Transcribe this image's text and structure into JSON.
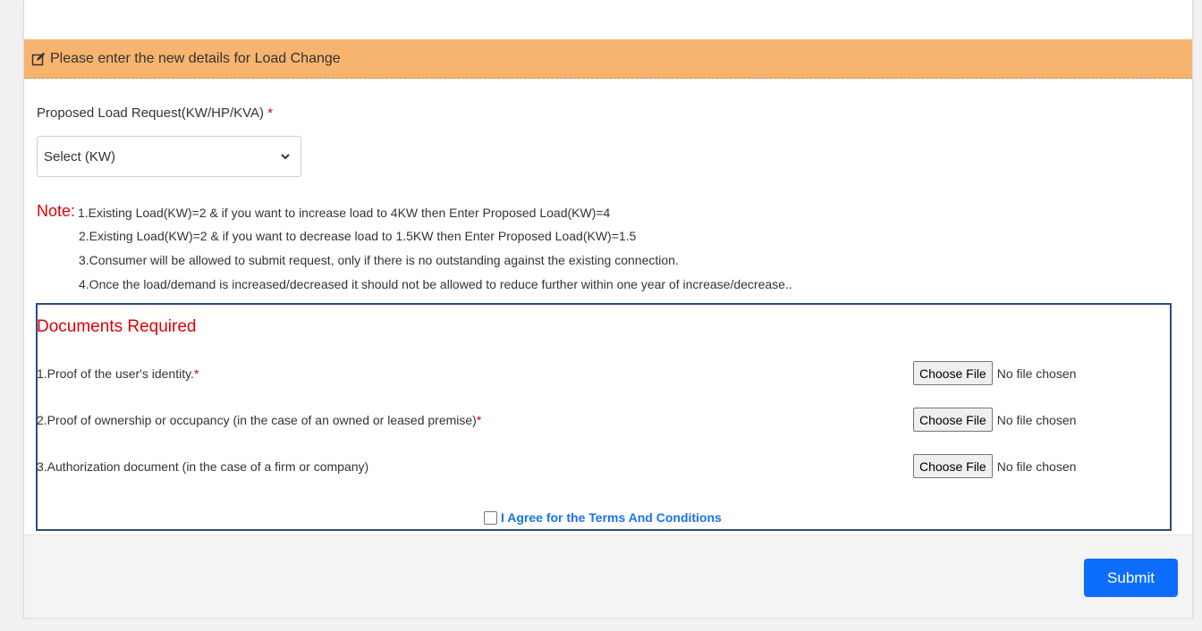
{
  "heading": {
    "title": "Please enter the new details for Load Change",
    "icon": "edit-icon",
    "color": "#f7b46e"
  },
  "load_request": {
    "label": "Proposed Load Request(KW/HP/KVA)",
    "required_mark": "*",
    "selected": "Select (KW)"
  },
  "notes": {
    "label": "Note:",
    "items": [
      "1.Existing Load(KW)=2 & if you want to increase load to 4KW then Enter Proposed Load(KW)=4",
      "2.Existing Load(KW)=2 & if you want to decrease load to 1.5KW then Enter Proposed Load(KW)=1.5",
      "3.Consumer will be allowed to submit request, only if there is no outstanding against the existing connection.",
      "4.Once the load/demand is increased/decreased it should not be allowed to reduce further within one year of increase/decrease.."
    ]
  },
  "documents": {
    "title": "Documents Required",
    "items": [
      {
        "label": "1.Proof of the user's identity.",
        "required_mark": "*",
        "button": "Choose File",
        "status": "No file chosen"
      },
      {
        "label": "2.Proof of ownership or occupancy (in the case of an owned or leased premise)",
        "required_mark": "*",
        "button": "Choose File",
        "status": "No file chosen"
      },
      {
        "label": "3.Authorization document (in the case of a firm or company)",
        "required_mark": "",
        "button": "Choose File",
        "status": "No file chosen"
      }
    ]
  },
  "terms": {
    "label": "I Agree for the Terms And Conditions",
    "checked": false
  },
  "submit_label": "Submit",
  "colors": {
    "accent": "#0d6efd",
    "required": "#e00000",
    "box_border": "#2e4e78"
  }
}
